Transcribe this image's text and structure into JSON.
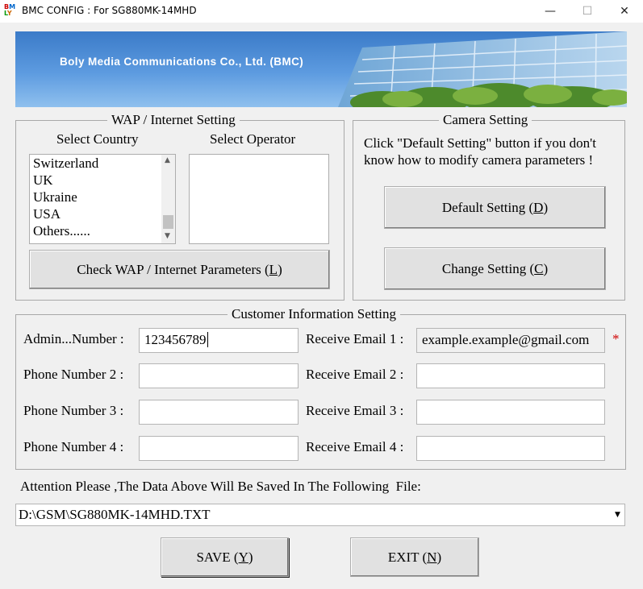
{
  "window": {
    "title": "BMC CONFIG : For SG880MK-14MHD",
    "minimize": "—",
    "maximize": "☐",
    "close": "✕"
  },
  "banner": {
    "company": "Boly Media Communications Co., Ltd. (BMC)"
  },
  "wap": {
    "legend": "WAP / Internet Setting",
    "country_label": "Select Country",
    "operator_label": "Select Operator",
    "countries": [
      "Switzerland",
      "UK",
      "Ukraine",
      "USA",
      "Others......"
    ],
    "operators": [],
    "check_button": {
      "text": "Check WAP / Internet Parameters (",
      "key": "L",
      "end": ")"
    }
  },
  "camera": {
    "legend": "Camera Setting",
    "hint_line1": "Click \"Default Setting\" button if you don't",
    "hint_line2": "know how to modify camera parameters !",
    "default_button": {
      "text": "Default Setting (",
      "key": "D",
      "end": ")"
    },
    "change_button": {
      "text": "Change Setting (",
      "key": "C",
      "end": ")"
    }
  },
  "customer": {
    "legend": "Customer Information Setting",
    "phones": [
      {
        "label": "Admin...Number :",
        "value": "123456789"
      },
      {
        "label": "Phone Number 2 :",
        "value": ""
      },
      {
        "label": "Phone Number 3 :",
        "value": ""
      },
      {
        "label": "Phone Number 4 :",
        "value": ""
      }
    ],
    "emails": [
      {
        "label": "Receive Email 1 :",
        "value": "example.example@gmail.com"
      },
      {
        "label": "Receive Email 2 :",
        "value": ""
      },
      {
        "label": "Receive Email 3 :",
        "value": ""
      },
      {
        "label": "Receive Email 4 :",
        "value": ""
      }
    ],
    "required_mark": "*",
    "required_color": "#d00000"
  },
  "save": {
    "attention": "Attention Please ,The Data Above Will Be Saved In The Following  File:",
    "file_path": "D:\\GSM\\SG880MK-14MHD.TXT"
  },
  "buttons": {
    "save": {
      "text": "SAVE (",
      "key": "Y",
      "end": ")"
    },
    "exit": {
      "text": "EXIT (",
      "key": "N",
      "end": ")"
    }
  }
}
